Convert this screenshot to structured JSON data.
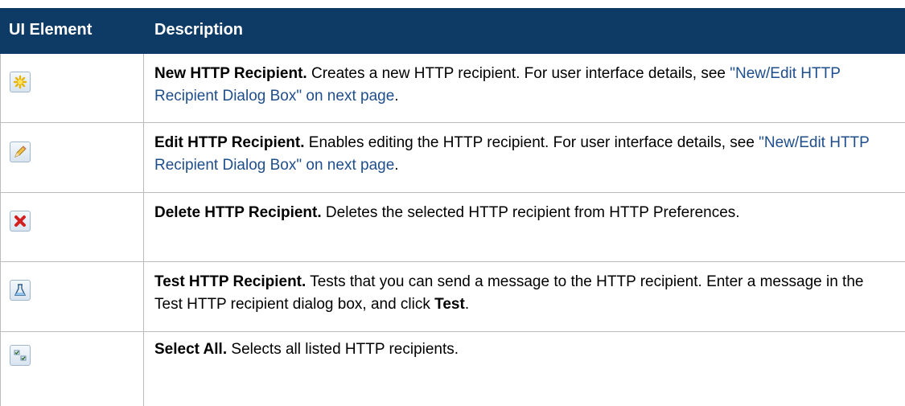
{
  "table": {
    "header": {
      "col1": "UI Element",
      "col2": "Description"
    },
    "rows": [
      {
        "icon": "new-star-icon",
        "title": "New HTTP Recipient.",
        "text": " Creates a new HTTP recipient. For user interface details, see ",
        "link": "\"New/Edit HTTP Recipient Dialog Box\" on next page",
        "tail": "."
      },
      {
        "icon": "edit-pencil-icon",
        "title": "Edit HTTP Recipient.",
        "text": " Enables editing the HTTP recipient. For user interface details, see ",
        "link": "\"New/Edit HTTP Recipient Dialog Box\" on next page",
        "tail": "."
      },
      {
        "icon": "delete-x-icon",
        "title": "Delete HTTP Recipient.",
        "text": " Deletes the selected HTTP recipient from HTTP Preferences."
      },
      {
        "icon": "test-flask-icon",
        "title": "Test HTTP Recipient.",
        "text": " Tests that you can send a message to the HTTP recipient. Enter a message in the Test HTTP recipient dialog box, and click ",
        "bold_tail": "Test",
        "tail": "."
      },
      {
        "icon": "select-all-icon",
        "title": "Select All.",
        "text": " Selects all listed HTTP recipients."
      }
    ]
  },
  "colors": {
    "header_bg": "#0e3a66",
    "link": "#1f4e8c",
    "border": "#bcbcbc"
  }
}
